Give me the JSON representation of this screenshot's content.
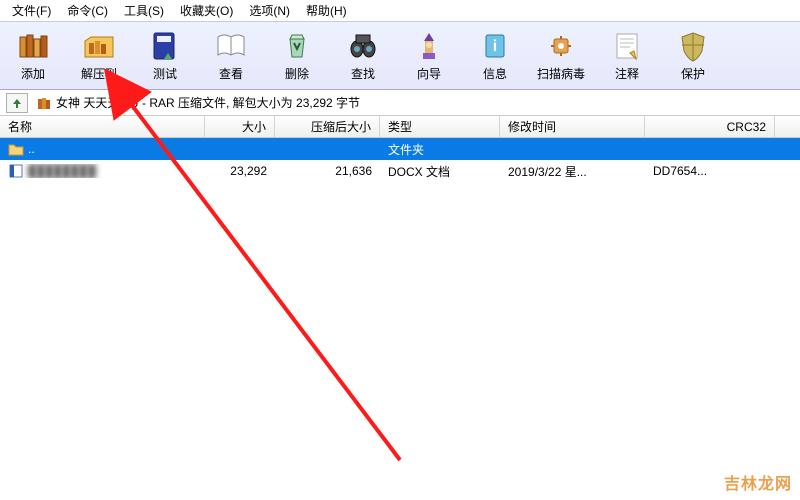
{
  "menu": {
    "file": "文件(F)",
    "command": "命令(C)",
    "tools": "工具(S)",
    "favorites": "收藏夹(O)",
    "options": "选项(N)",
    "help": "帮助(H)"
  },
  "toolbar": {
    "add": "添加",
    "extract_to": "解压到",
    "test": "测试",
    "view": "查看",
    "delete": "删除",
    "find": "查找",
    "wizard": "向导",
    "info": "信息",
    "virusscan": "扫描病毒",
    "comment": "注释",
    "protect": "保护"
  },
  "archive": {
    "name": "女神   天天天.zip",
    "desc": " - RAR 压缩文件, 解包大小为 23,292 字节"
  },
  "columns": {
    "name": "名称",
    "size": "大小",
    "packed": "压缩后大小",
    "type": "类型",
    "modified": "修改时间",
    "crc": "CRC32"
  },
  "rows": {
    "parent": {
      "name": "..",
      "type": "文件夹"
    },
    "file1": {
      "size": "23,292",
      "packed": "21,636",
      "type": "DOCX 文档",
      "modified": "2019/3/22 星...",
      "crc": "DD7654..."
    }
  },
  "watermark": "吉林龙网"
}
